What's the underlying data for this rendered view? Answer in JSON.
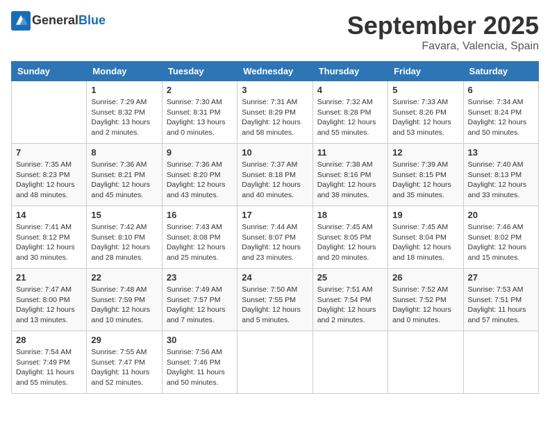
{
  "header": {
    "logo_line1": "General",
    "logo_line2": "Blue",
    "month": "September 2025",
    "location": "Favara, Valencia, Spain"
  },
  "days_of_week": [
    "Sunday",
    "Monday",
    "Tuesday",
    "Wednesday",
    "Thursday",
    "Friday",
    "Saturday"
  ],
  "weeks": [
    [
      {
        "day": "",
        "sunrise": "",
        "sunset": "",
        "daylight": ""
      },
      {
        "day": "1",
        "sunrise": "Sunrise: 7:29 AM",
        "sunset": "Sunset: 8:32 PM",
        "daylight": "Daylight: 13 hours and 2 minutes."
      },
      {
        "day": "2",
        "sunrise": "Sunrise: 7:30 AM",
        "sunset": "Sunset: 8:31 PM",
        "daylight": "Daylight: 13 hours and 0 minutes."
      },
      {
        "day": "3",
        "sunrise": "Sunrise: 7:31 AM",
        "sunset": "Sunset: 8:29 PM",
        "daylight": "Daylight: 12 hours and 58 minutes."
      },
      {
        "day": "4",
        "sunrise": "Sunrise: 7:32 AM",
        "sunset": "Sunset: 8:28 PM",
        "daylight": "Daylight: 12 hours and 55 minutes."
      },
      {
        "day": "5",
        "sunrise": "Sunrise: 7:33 AM",
        "sunset": "Sunset: 8:26 PM",
        "daylight": "Daylight: 12 hours and 53 minutes."
      },
      {
        "day": "6",
        "sunrise": "Sunrise: 7:34 AM",
        "sunset": "Sunset: 8:24 PM",
        "daylight": "Daylight: 12 hours and 50 minutes."
      }
    ],
    [
      {
        "day": "7",
        "sunrise": "Sunrise: 7:35 AM",
        "sunset": "Sunset: 8:23 PM",
        "daylight": "Daylight: 12 hours and 48 minutes."
      },
      {
        "day": "8",
        "sunrise": "Sunrise: 7:36 AM",
        "sunset": "Sunset: 8:21 PM",
        "daylight": "Daylight: 12 hours and 45 minutes."
      },
      {
        "day": "9",
        "sunrise": "Sunrise: 7:36 AM",
        "sunset": "Sunset: 8:20 PM",
        "daylight": "Daylight: 12 hours and 43 minutes."
      },
      {
        "day": "10",
        "sunrise": "Sunrise: 7:37 AM",
        "sunset": "Sunset: 8:18 PM",
        "daylight": "Daylight: 12 hours and 40 minutes."
      },
      {
        "day": "11",
        "sunrise": "Sunrise: 7:38 AM",
        "sunset": "Sunset: 8:16 PM",
        "daylight": "Daylight: 12 hours and 38 minutes."
      },
      {
        "day": "12",
        "sunrise": "Sunrise: 7:39 AM",
        "sunset": "Sunset: 8:15 PM",
        "daylight": "Daylight: 12 hours and 35 minutes."
      },
      {
        "day": "13",
        "sunrise": "Sunrise: 7:40 AM",
        "sunset": "Sunset: 8:13 PM",
        "daylight": "Daylight: 12 hours and 33 minutes."
      }
    ],
    [
      {
        "day": "14",
        "sunrise": "Sunrise: 7:41 AM",
        "sunset": "Sunset: 8:12 PM",
        "daylight": "Daylight: 12 hours and 30 minutes."
      },
      {
        "day": "15",
        "sunrise": "Sunrise: 7:42 AM",
        "sunset": "Sunset: 8:10 PM",
        "daylight": "Daylight: 12 hours and 28 minutes."
      },
      {
        "day": "16",
        "sunrise": "Sunrise: 7:43 AM",
        "sunset": "Sunset: 8:08 PM",
        "daylight": "Daylight: 12 hours and 25 minutes."
      },
      {
        "day": "17",
        "sunrise": "Sunrise: 7:44 AM",
        "sunset": "Sunset: 8:07 PM",
        "daylight": "Daylight: 12 hours and 23 minutes."
      },
      {
        "day": "18",
        "sunrise": "Sunrise: 7:45 AM",
        "sunset": "Sunset: 8:05 PM",
        "daylight": "Daylight: 12 hours and 20 minutes."
      },
      {
        "day": "19",
        "sunrise": "Sunrise: 7:45 AM",
        "sunset": "Sunset: 8:04 PM",
        "daylight": "Daylight: 12 hours and 18 minutes."
      },
      {
        "day": "20",
        "sunrise": "Sunrise: 7:46 AM",
        "sunset": "Sunset: 8:02 PM",
        "daylight": "Daylight: 12 hours and 15 minutes."
      }
    ],
    [
      {
        "day": "21",
        "sunrise": "Sunrise: 7:47 AM",
        "sunset": "Sunset: 8:00 PM",
        "daylight": "Daylight: 12 hours and 13 minutes."
      },
      {
        "day": "22",
        "sunrise": "Sunrise: 7:48 AM",
        "sunset": "Sunset: 7:59 PM",
        "daylight": "Daylight: 12 hours and 10 minutes."
      },
      {
        "day": "23",
        "sunrise": "Sunrise: 7:49 AM",
        "sunset": "Sunset: 7:57 PM",
        "daylight": "Daylight: 12 hours and 7 minutes."
      },
      {
        "day": "24",
        "sunrise": "Sunrise: 7:50 AM",
        "sunset": "Sunset: 7:55 PM",
        "daylight": "Daylight: 12 hours and 5 minutes."
      },
      {
        "day": "25",
        "sunrise": "Sunrise: 7:51 AM",
        "sunset": "Sunset: 7:54 PM",
        "daylight": "Daylight: 12 hours and 2 minutes."
      },
      {
        "day": "26",
        "sunrise": "Sunrise: 7:52 AM",
        "sunset": "Sunset: 7:52 PM",
        "daylight": "Daylight: 12 hours and 0 minutes."
      },
      {
        "day": "27",
        "sunrise": "Sunrise: 7:53 AM",
        "sunset": "Sunset: 7:51 PM",
        "daylight": "Daylight: 11 hours and 57 minutes."
      }
    ],
    [
      {
        "day": "28",
        "sunrise": "Sunrise: 7:54 AM",
        "sunset": "Sunset: 7:49 PM",
        "daylight": "Daylight: 11 hours and 55 minutes."
      },
      {
        "day": "29",
        "sunrise": "Sunrise: 7:55 AM",
        "sunset": "Sunset: 7:47 PM",
        "daylight": "Daylight: 11 hours and 52 minutes."
      },
      {
        "day": "30",
        "sunrise": "Sunrise: 7:56 AM",
        "sunset": "Sunset: 7:46 PM",
        "daylight": "Daylight: 11 hours and 50 minutes."
      },
      {
        "day": "",
        "sunrise": "",
        "sunset": "",
        "daylight": ""
      },
      {
        "day": "",
        "sunrise": "",
        "sunset": "",
        "daylight": ""
      },
      {
        "day": "",
        "sunrise": "",
        "sunset": "",
        "daylight": ""
      },
      {
        "day": "",
        "sunrise": "",
        "sunset": "",
        "daylight": ""
      }
    ]
  ]
}
